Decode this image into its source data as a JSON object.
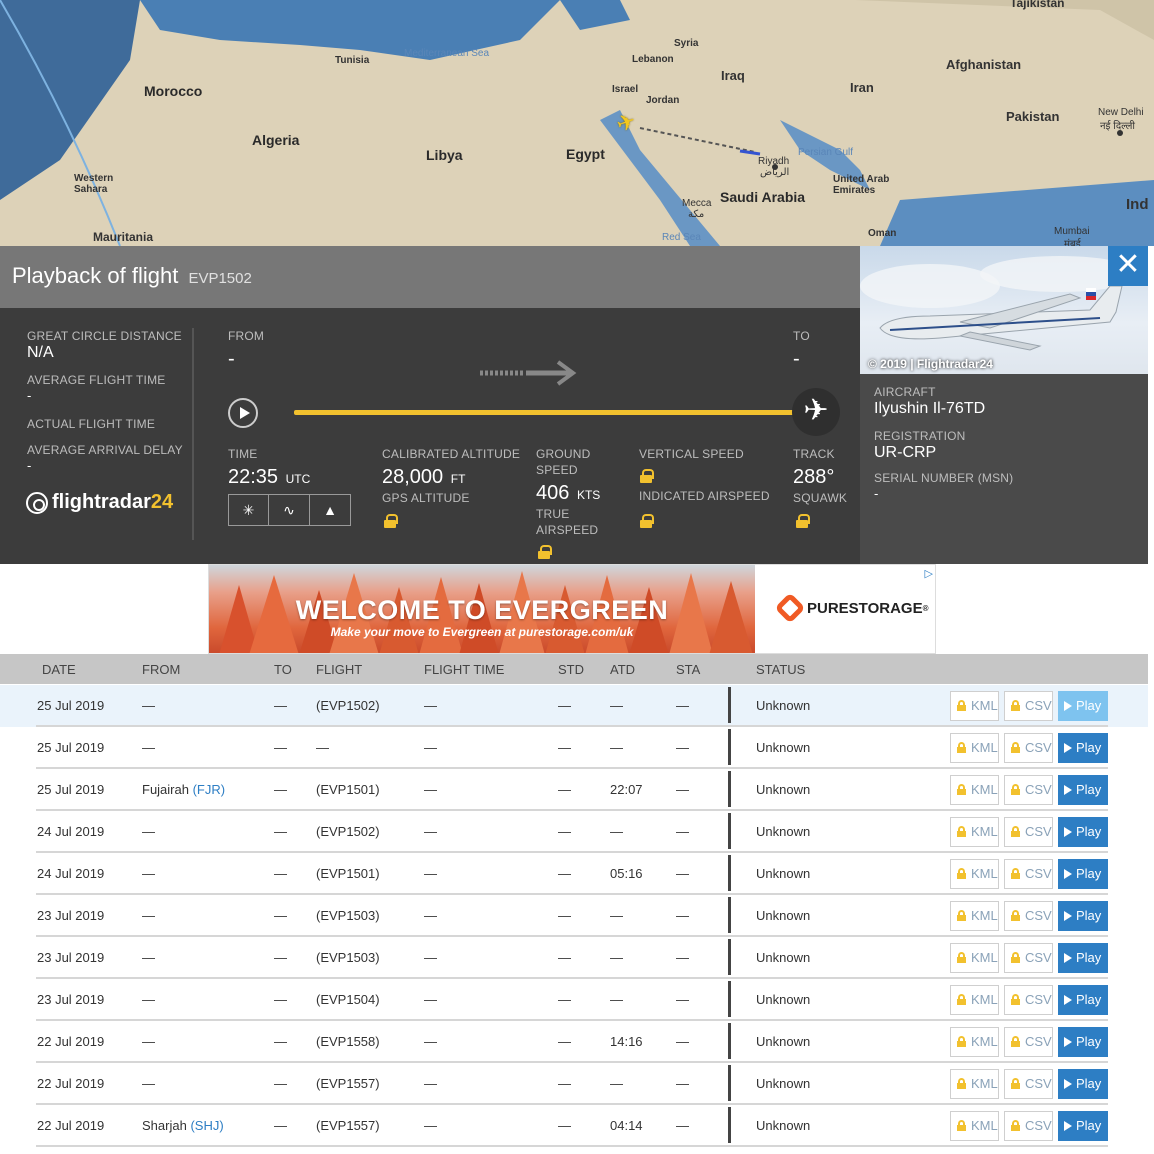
{
  "map": {
    "labels": {
      "tunisia": "Tunisia",
      "med_sea": "Mediterranean Sea",
      "syria": "Syria",
      "lebanon": "Lebanon",
      "iraq": "Iraq",
      "afghanistan": "Afghanistan",
      "iran": "Iran",
      "israel": "Israel",
      "jordan": "Jordan",
      "pakistan": "Pakistan",
      "new_delhi": "New Delhi",
      "new_delhi_hi": "नई दिल्ली",
      "morocco": "Morocco",
      "algeria": "Algeria",
      "libya": "Libya",
      "egypt": "Egypt",
      "riyadh": "Riyadh",
      "riyadh_ar": "الرياض",
      "persian_gulf": "Persian Gulf",
      "uae": "United Arab Emirates",
      "western_sahara": "Western Sahara",
      "saudi": "Saudi Arabia",
      "mecca": "Mecca",
      "mecca_ar": "مكة",
      "mauritania": "Mauritania",
      "red_sea": "Red Sea",
      "oman": "Oman",
      "mumbai": "Mumbai",
      "mumbai_hi": "मंबई",
      "india": "Ind",
      "tajikistan": "Tajikistan"
    }
  },
  "playback": {
    "title": "Playback of flight",
    "flight": "EVP1502",
    "great_circle_label": "GREAT CIRCLE DISTANCE",
    "great_circle_value": "N/A",
    "avg_flight_time_label": "AVERAGE FLIGHT TIME",
    "avg_flight_time_value": "-",
    "actual_flight_time_label": "ACTUAL FLIGHT TIME",
    "avg_arrival_delay_label": "AVERAGE ARRIVAL DELAY",
    "avg_arrival_delay_value": "-",
    "logo_text": "flightradar",
    "logo_num": "24",
    "from_label": "FROM",
    "from_value": "-",
    "to_label": "TO",
    "to_value": "-",
    "progress": 1.0,
    "time_label": "TIME",
    "time_value": "22:35",
    "time_unit": "UTC",
    "cal_alt_label": "CALIBRATED ALTITUDE",
    "cal_alt_value": "28,000",
    "cal_alt_unit": "FT",
    "gps_alt_label": "GPS ALTITUDE",
    "ground_speed_label": "GROUND SPEED",
    "ground_speed_value": "406",
    "ground_speed_unit": "KTS",
    "true_airspeed_label": "TRUE AIRSPEED",
    "vertical_speed_label": "VERTICAL SPEED",
    "indicated_airspeed_label": "INDICATED AIRSPEED",
    "track_label": "TRACK",
    "track_value": "288°",
    "squawk_label": "SQUAWK"
  },
  "aircraft": {
    "photo_credit": "© 2019 | Flightradar24",
    "aircraft_label": "AIRCRAFT",
    "aircraft_value": "Ilyushin Il-76TD",
    "registration_label": "REGISTRATION",
    "registration_value": "UR-CRP",
    "serial_label": "SERIAL NUMBER (MSN)",
    "serial_value": "-"
  },
  "ad": {
    "headline": "WELCOME TO EVERGREEN",
    "sub": "Make your move to Evergreen at purestorage.com/uk",
    "brand": "PURESTORAGE",
    "brand_mark": "®"
  },
  "table": {
    "headers": [
      "DATE",
      "FROM",
      "TO",
      "FLIGHT",
      "FLIGHT TIME",
      "STD",
      "ATD",
      "STA",
      "STATUS"
    ],
    "kml_label": "KML",
    "csv_label": "CSV",
    "play_label": "Play",
    "rows": [
      {
        "date": "25 Jul 2019",
        "from": "—",
        "from_code": "",
        "to": "—",
        "flight": "(EVP1502)",
        "flight_time": "—",
        "std": "—",
        "atd": "—",
        "sta": "—",
        "status": "Unknown"
      },
      {
        "date": "25 Jul 2019",
        "from": "—",
        "from_code": "",
        "to": "—",
        "flight": "—",
        "flight_time": "—",
        "std": "—",
        "atd": "—",
        "sta": "—",
        "status": "Unknown"
      },
      {
        "date": "25 Jul 2019",
        "from": "Fujairah",
        "from_code": "(FJR)",
        "to": "—",
        "flight": "(EVP1501)",
        "flight_time": "—",
        "std": "—",
        "atd": "22:07",
        "sta": "—",
        "status": "Unknown"
      },
      {
        "date": "24 Jul 2019",
        "from": "—",
        "from_code": "",
        "to": "—",
        "flight": "(EVP1502)",
        "flight_time": "—",
        "std": "—",
        "atd": "—",
        "sta": "—",
        "status": "Unknown"
      },
      {
        "date": "24 Jul 2019",
        "from": "—",
        "from_code": "",
        "to": "—",
        "flight": "(EVP1501)",
        "flight_time": "—",
        "std": "—",
        "atd": "05:16",
        "sta": "—",
        "status": "Unknown"
      },
      {
        "date": "23 Jul 2019",
        "from": "—",
        "from_code": "",
        "to": "—",
        "flight": "(EVP1503)",
        "flight_time": "—",
        "std": "—",
        "atd": "—",
        "sta": "—",
        "status": "Unknown"
      },
      {
        "date": "23 Jul 2019",
        "from": "—",
        "from_code": "",
        "to": "—",
        "flight": "(EVP1503)",
        "flight_time": "—",
        "std": "—",
        "atd": "—",
        "sta": "—",
        "status": "Unknown"
      },
      {
        "date": "23 Jul 2019",
        "from": "—",
        "from_code": "",
        "to": "—",
        "flight": "(EVP1504)",
        "flight_time": "—",
        "std": "—",
        "atd": "—",
        "sta": "—",
        "status": "Unknown"
      },
      {
        "date": "22 Jul 2019",
        "from": "—",
        "from_code": "",
        "to": "—",
        "flight": "(EVP1558)",
        "flight_time": "—",
        "std": "—",
        "atd": "14:16",
        "sta": "—",
        "status": "Unknown"
      },
      {
        "date": "22 Jul 2019",
        "from": "—",
        "from_code": "",
        "to": "—",
        "flight": "(EVP1557)",
        "flight_time": "—",
        "std": "—",
        "atd": "—",
        "sta": "—",
        "status": "Unknown"
      },
      {
        "date": "22 Jul 2019",
        "from": "Sharjah",
        "from_code": "(SHJ)",
        "to": "—",
        "flight": "(EVP1557)",
        "flight_time": "—",
        "std": "—",
        "atd": "04:14",
        "sta": "—",
        "status": "Unknown"
      }
    ]
  }
}
